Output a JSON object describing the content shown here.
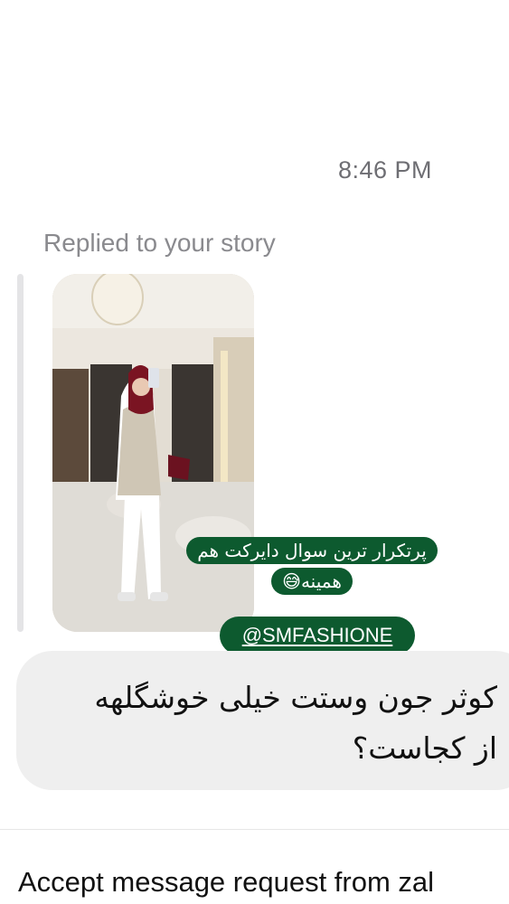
{
  "thread": {
    "timestamp": "8:46 PM",
    "reply_label": "Replied to your story"
  },
  "story": {
    "caption_line1": "پرتکرار ترین سوال دایرکت هم",
    "caption_line2": "همینه😅",
    "mention": "@SMFASHIONE",
    "caption_color": "#0d5a2f"
  },
  "message": {
    "line1": "کوثر جون وستت خیلی خوشگلهه",
    "line2": "از کجاست؟",
    "bubble_color": "#efefef"
  },
  "request": {
    "prompt": "Accept message request from zal"
  }
}
